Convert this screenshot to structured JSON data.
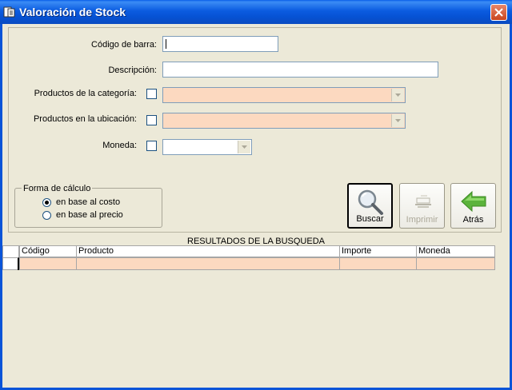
{
  "window": {
    "title": "Valoración de Stock"
  },
  "form": {
    "barcode_label": "Código de barra:",
    "barcode_value": "",
    "description_label": "Descripción:",
    "description_value": "",
    "category_label": "Productos de la categoría:",
    "category_value": "",
    "location_label": "Productos en la ubicación:",
    "location_value": "",
    "currency_label": "Moneda:",
    "currency_value": ""
  },
  "calc": {
    "legend": "Forma de cálculo",
    "options": [
      {
        "label": "en base al costo",
        "selected": true
      },
      {
        "label": "en base al precio",
        "selected": false
      }
    ]
  },
  "buttons": {
    "search": "Buscar",
    "print": "Imprimir",
    "back": "Atrás"
  },
  "results": {
    "title": "RESULTADOS DE LA BUSQUEDA",
    "columns": [
      "Código",
      "Producto",
      "Importe",
      "Moneda"
    ]
  },
  "colors": {
    "titlebar": "#0A5FE8",
    "window_bg": "#ECE9D8",
    "combo_bg": "#FCD9C0",
    "back_arrow": "#5BB33B"
  },
  "icons": {
    "app": "book-page-icon",
    "close": "close-x-icon",
    "search": "magnifier-icon",
    "print": "printer-icon",
    "back": "green-left-arrow-icon"
  }
}
